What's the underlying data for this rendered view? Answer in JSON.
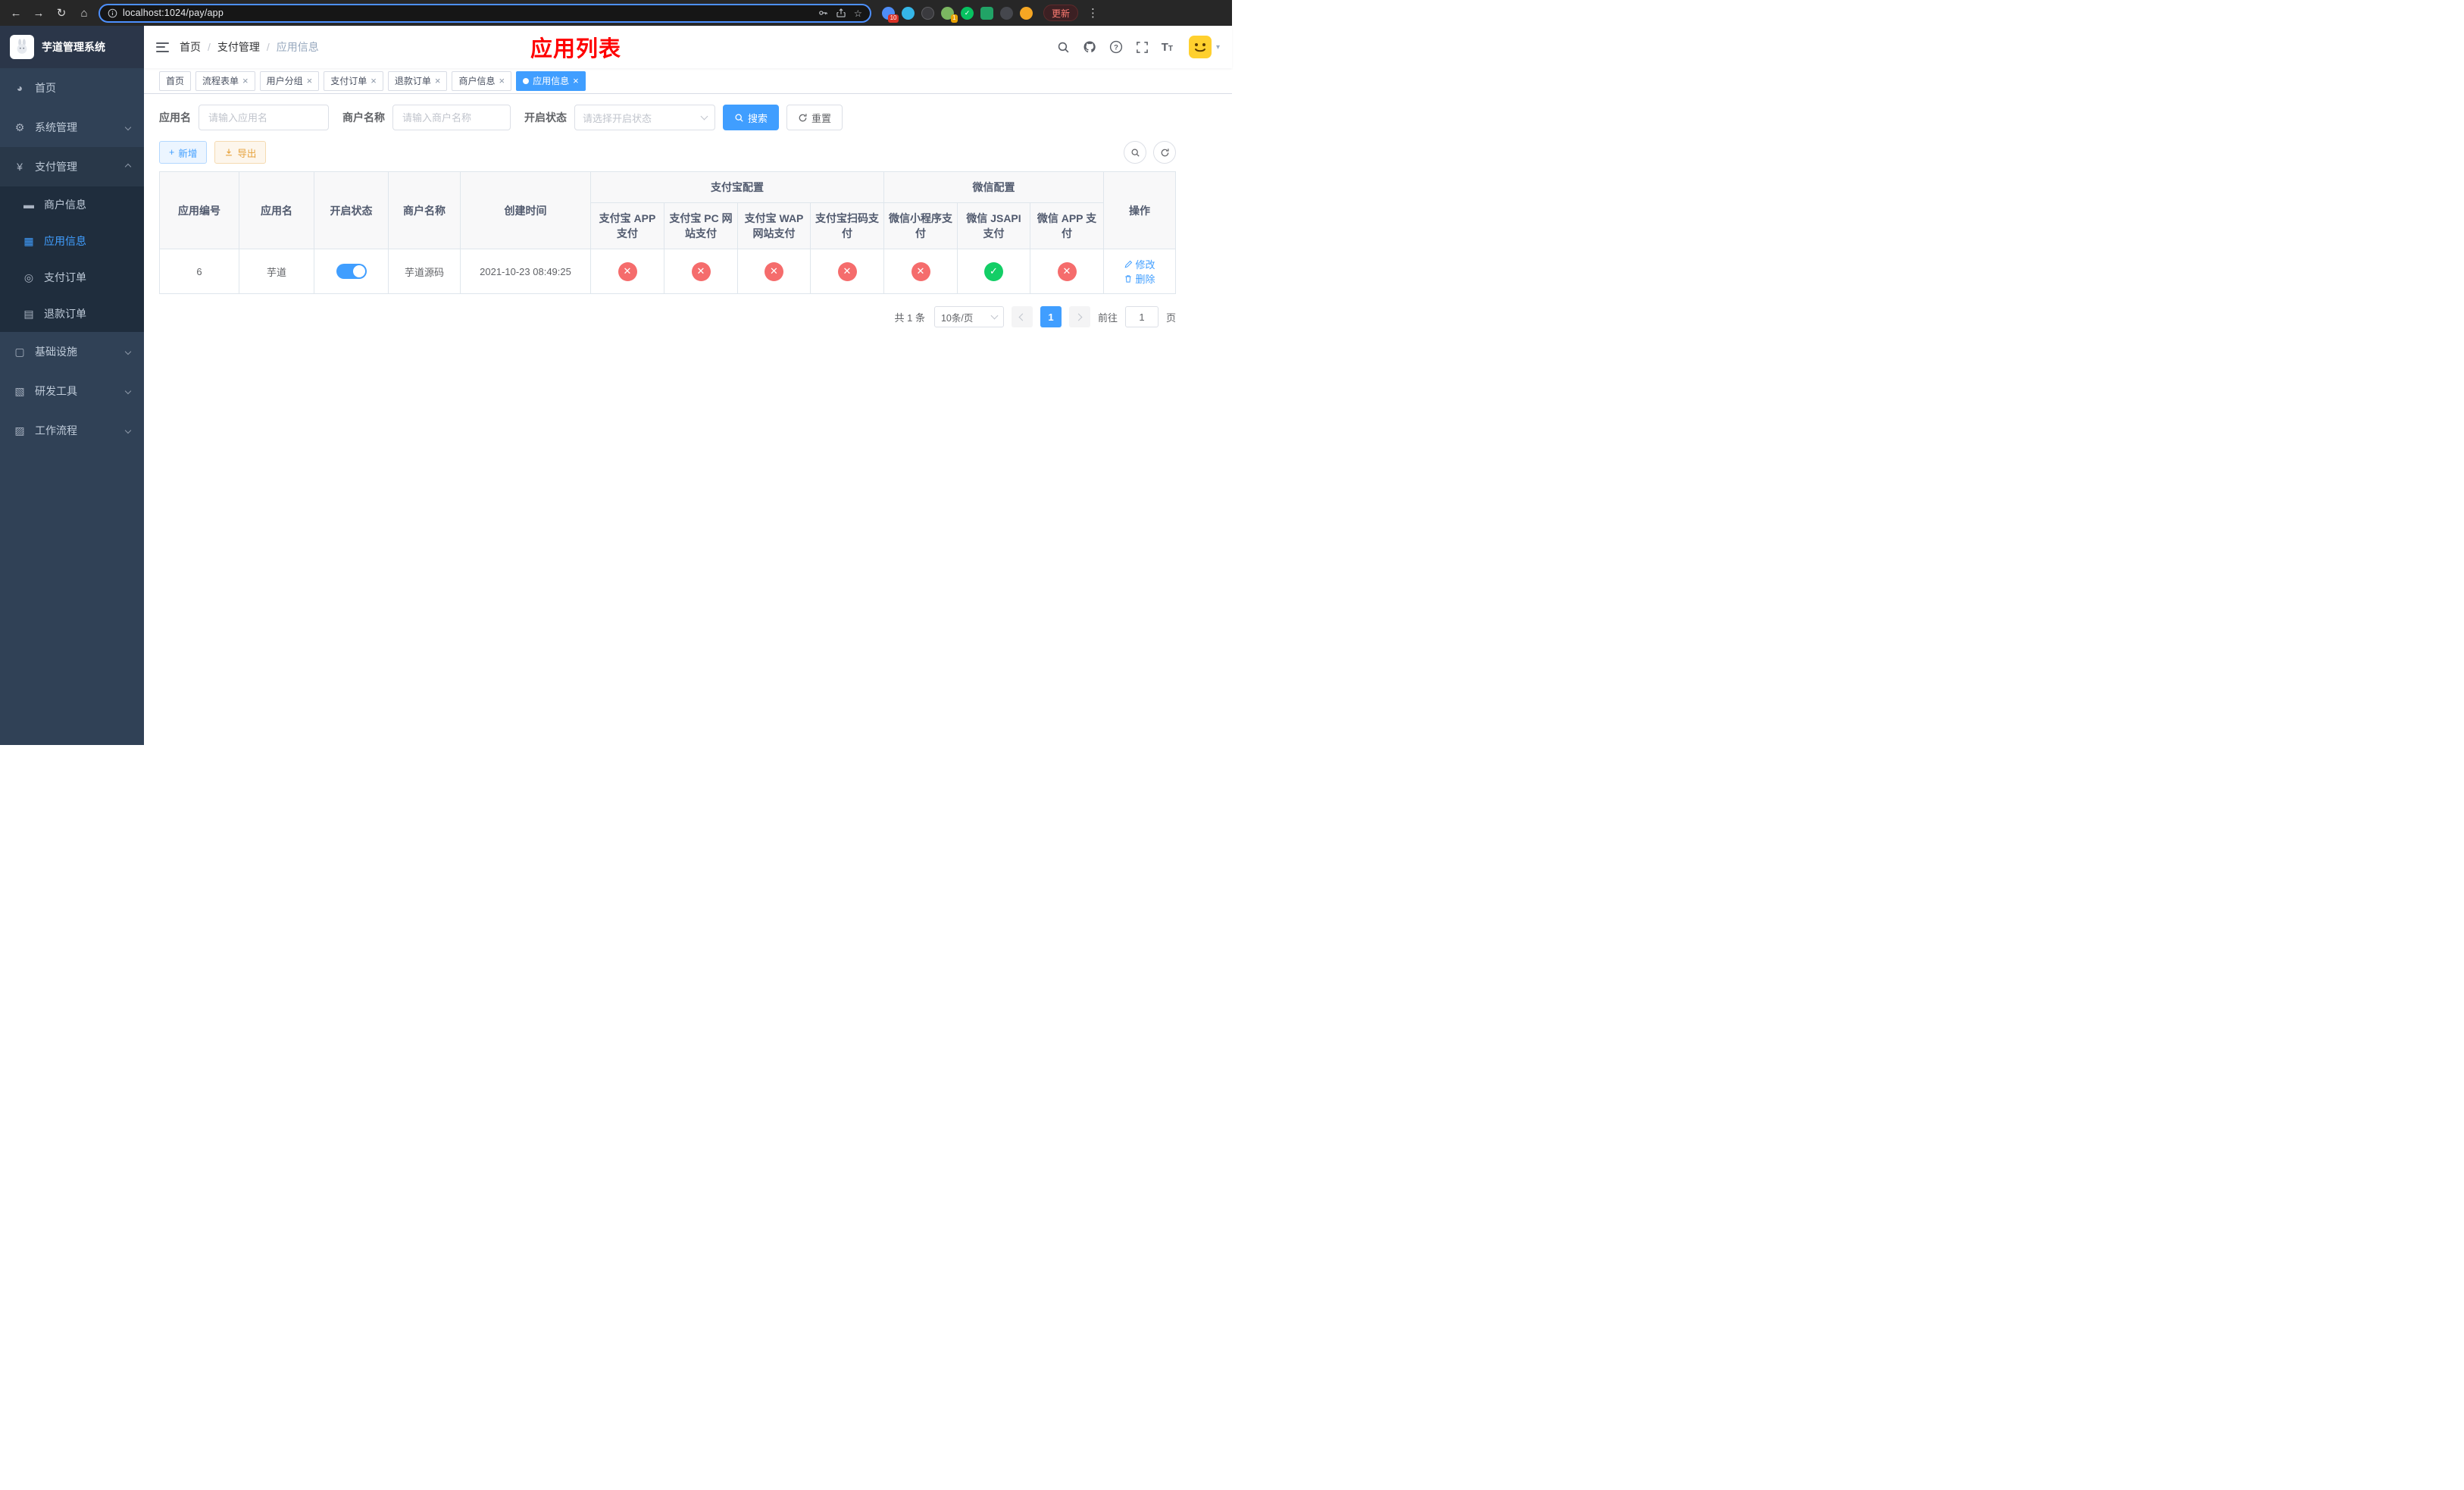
{
  "colors": {
    "accent": "#409eff",
    "danger": "#f56c6c",
    "success": "#13ce66",
    "warning": "#e6a23c",
    "title_red": "#ff0000"
  },
  "icons": {
    "check": "✓",
    "cross": "✕",
    "close": "×",
    "back": "←",
    "forward": "→",
    "reload": "↻",
    "home": "⌂",
    "star": "☆",
    "menu_dots": "⋮",
    "slash": "/",
    "plus": "+"
  },
  "browser": {
    "url": "localhost:1024/pay/app",
    "update_label": "更新",
    "ext_badge_puzzle": "10",
    "ext_badge_avatar": "1"
  },
  "sidebar": {
    "logo_title": "芋道管理系统",
    "items": [
      {
        "label": "首页"
      },
      {
        "label": "系统管理"
      },
      {
        "label": "支付管理"
      },
      {
        "label": "基础设施"
      },
      {
        "label": "研发工具"
      },
      {
        "label": "工作流程"
      }
    ],
    "payment_children": [
      {
        "label": "商户信息"
      },
      {
        "label": "应用信息"
      },
      {
        "label": "支付订单"
      },
      {
        "label": "退款订单"
      }
    ]
  },
  "header": {
    "breadcrumb": [
      "首页",
      "支付管理",
      "应用信息"
    ],
    "title": "应用列表"
  },
  "tabs": [
    {
      "label": "首页"
    },
    {
      "label": "流程表单"
    },
    {
      "label": "用户分组"
    },
    {
      "label": "支付订单"
    },
    {
      "label": "退款订单"
    },
    {
      "label": "商户信息"
    },
    {
      "label": "应用信息"
    }
  ],
  "filters": {
    "app_name_label": "应用名",
    "app_name_placeholder": "请输入应用名",
    "merchant_label": "商户名称",
    "merchant_placeholder": "请输入商户名称",
    "status_label": "开启状态",
    "status_placeholder": "请选择开启状态",
    "search_label": "搜索",
    "reset_label": "重置"
  },
  "toolbar": {
    "add_label": "新增",
    "export_label": "导出"
  },
  "table": {
    "groups": {
      "alipay": "支付宝配置",
      "wechat": "微信配置"
    },
    "columns": {
      "id": "应用编号",
      "name": "应用名",
      "status": "开启状态",
      "merchant": "商户名称",
      "created": "创建时间",
      "alipay_app": "支付宝 APP 支付",
      "alipay_pc": "支付宝 PC 网站支付",
      "alipay_wap": "支付宝 WAP 网站支付",
      "alipay_qr": "支付宝扫码支付",
      "wx_mini": "微信小程序支付",
      "wx_jsapi": "微信 JSAPI 支付",
      "wx_app": "微信 APP 支付",
      "actions": "操作"
    },
    "rows": [
      {
        "id": "6",
        "name": "芋道",
        "enabled": true,
        "merchant": "芋道源码",
        "created": "2021-10-23 08:49:25",
        "statuses": [
          false,
          false,
          false,
          false,
          false,
          true,
          false
        ],
        "edit_label": "修改",
        "delete_label": "删除"
      }
    ]
  },
  "pagination": {
    "total_text": "共 1 条",
    "page_size_text": "10条/页",
    "page": "1",
    "goto_prefix": "前往",
    "goto_value": "1",
    "goto_suffix": "页"
  }
}
